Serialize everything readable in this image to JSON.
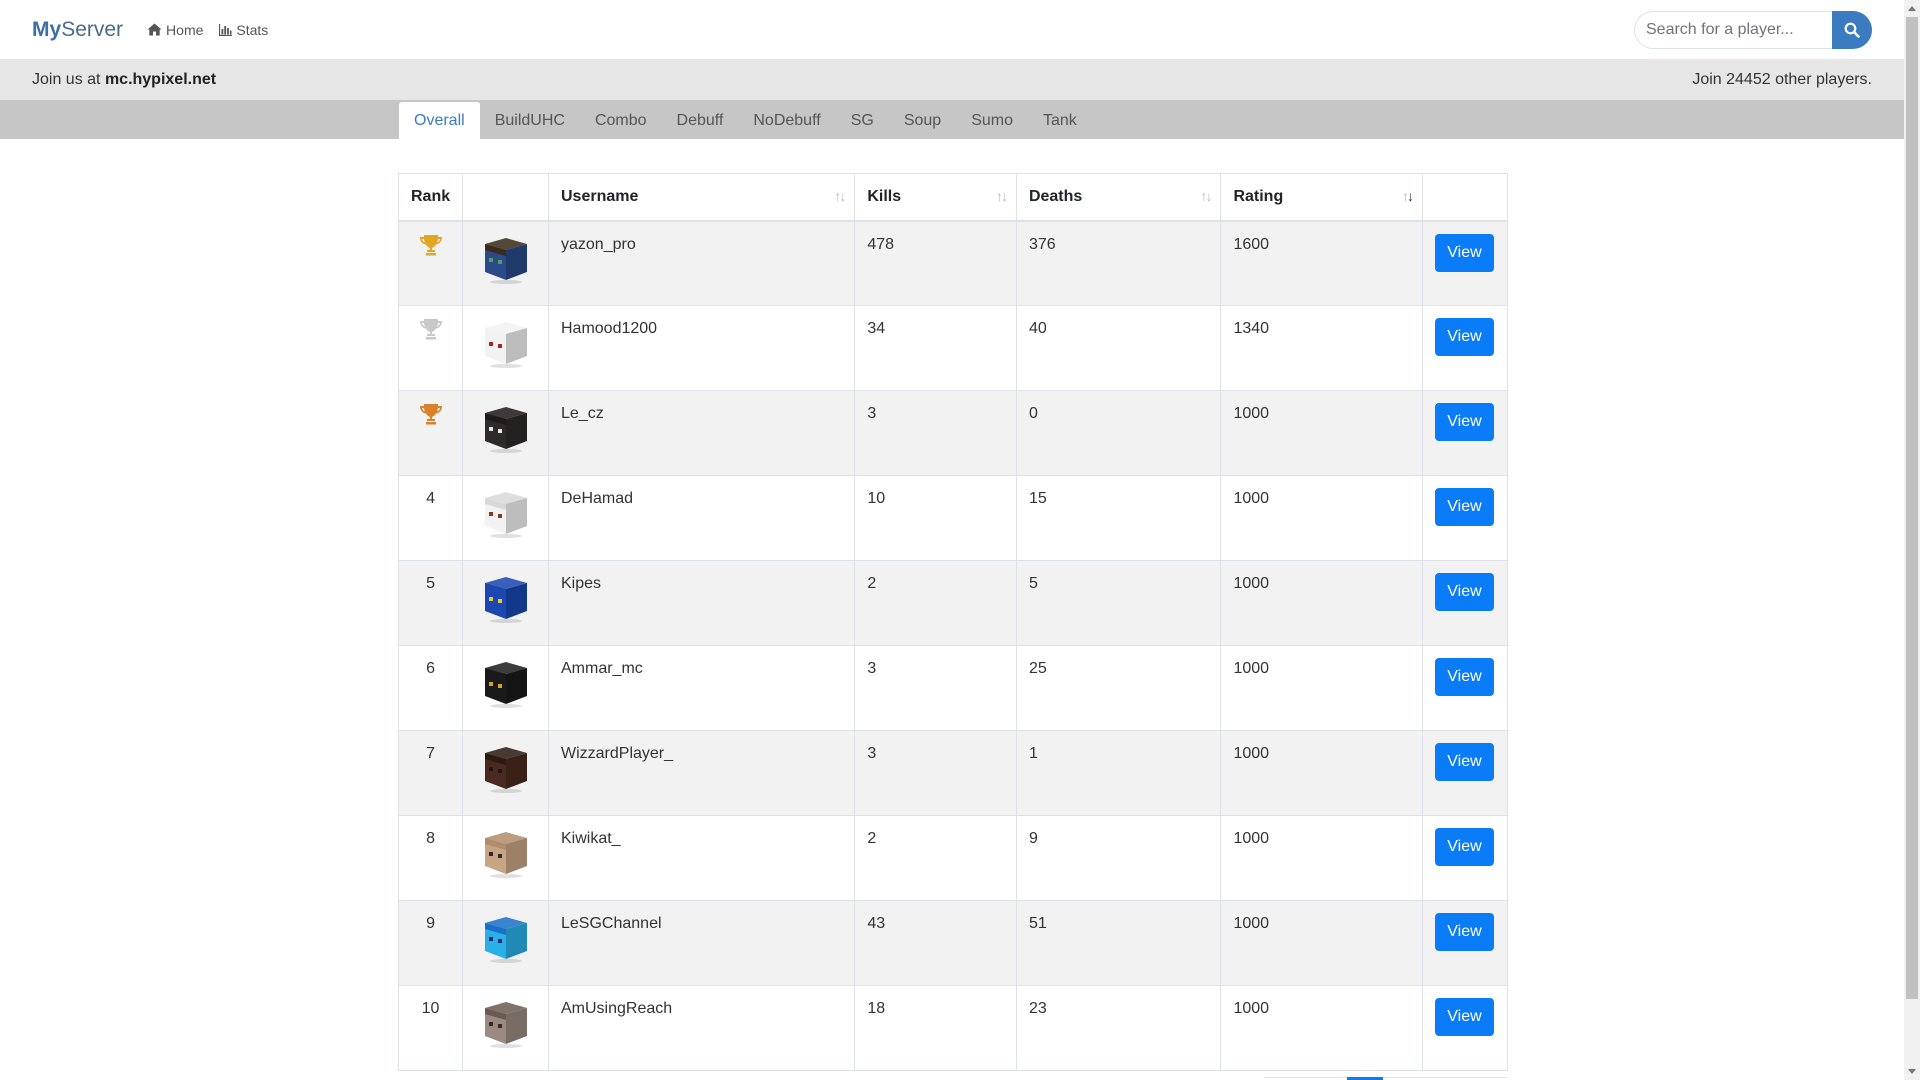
{
  "navbar": {
    "brand_strong": "My",
    "brand_rest": "Server",
    "links": [
      {
        "label": "Home",
        "icon": "home-icon"
      },
      {
        "label": "Stats",
        "icon": "bar-chart-icon"
      }
    ],
    "search_placeholder": "Search for a player...",
    "search_icon": "search-icon"
  },
  "infobar": {
    "join_prefix": "Join us at ",
    "server_address": "mc.hypixel.net",
    "player_count_text": "Join 24452 other players."
  },
  "tabs": [
    {
      "label": "Overall",
      "active": true
    },
    {
      "label": "BuildUHC",
      "active": false
    },
    {
      "label": "Combo",
      "active": false
    },
    {
      "label": "Debuff",
      "active": false
    },
    {
      "label": "NoDebuff",
      "active": false
    },
    {
      "label": "SG",
      "active": false
    },
    {
      "label": "Soup",
      "active": false
    },
    {
      "label": "Sumo",
      "active": false
    },
    {
      "label": "Tank",
      "active": false
    }
  ],
  "table": {
    "headers": {
      "rank": "Rank",
      "skin": "",
      "username": "Username",
      "kills": "Kills",
      "deaths": "Deaths",
      "rating": "Rating",
      "actions": ""
    },
    "sorted_column": "rating",
    "view_label": "View",
    "trophy_colors": {
      "gold": "#e2a622",
      "silver": "#c8c8c8",
      "bronze": "#d9822b"
    },
    "rows": [
      {
        "rank": "",
        "trophy": "gold",
        "username": "yazon_pro",
        "kills": "478",
        "deaths": "376",
        "rating": "1600",
        "skin": {
          "face": "#2a4a8a",
          "hair": "#3a2a1a",
          "accent": "#5a9a5a"
        }
      },
      {
        "rank": "",
        "trophy": "silver",
        "username": "Hamood1200",
        "kills": "34",
        "deaths": "40",
        "rating": "1340",
        "skin": {
          "face": "#f2f2f2",
          "hair": "#f2f2f2",
          "accent": "#b02020"
        }
      },
      {
        "rank": "",
        "trophy": "bronze",
        "username": "Le_cz",
        "kills": "3",
        "deaths": "0",
        "rating": "1000",
        "skin": {
          "face": "#2e2a2a",
          "hair": "#1e1a1a",
          "accent": "#e8e8e8"
        }
      },
      {
        "rank": "4",
        "trophy": "",
        "username": "DeHamad",
        "kills": "10",
        "deaths": "15",
        "rating": "1000",
        "skin": {
          "face": "#f2f2f2",
          "hair": "#d8d8d8",
          "accent": "#8a3a1a"
        }
      },
      {
        "rank": "5",
        "trophy": "",
        "username": "Kipes",
        "kills": "2",
        "deaths": "5",
        "rating": "1000",
        "skin": {
          "face": "#1a48b0",
          "hair": "#1a48b0",
          "accent": "#e8c840"
        }
      },
      {
        "rank": "6",
        "trophy": "",
        "username": "Ammar_mc",
        "kills": "3",
        "deaths": "25",
        "rating": "1000",
        "skin": {
          "face": "#1a1a1a",
          "hair": "#1a1a1a",
          "accent": "#e0a020"
        }
      },
      {
        "rank": "7",
        "trophy": "",
        "username": "WizzardPlayer_",
        "kills": "3",
        "deaths": "1",
        "rating": "1000",
        "skin": {
          "face": "#4a2a1e",
          "hair": "#2a1a12",
          "accent": "#1a1a1a"
        }
      },
      {
        "rank": "8",
        "trophy": "",
        "username": "Kiwikat_",
        "kills": "2",
        "deaths": "9",
        "rating": "1000",
        "skin": {
          "face": "#c8a484",
          "hair": "#b08c6c",
          "accent": "#2a2a2a"
        }
      },
      {
        "rank": "9",
        "trophy": "",
        "username": "LeSGChannel",
        "kills": "43",
        "deaths": "51",
        "rating": "1000",
        "skin": {
          "face": "#2ab0e8",
          "hair": "#1a70c8",
          "accent": "#1a2a6a"
        }
      },
      {
        "rank": "10",
        "trophy": "",
        "username": "AmUsingReach",
        "kills": "18",
        "deaths": "23",
        "rating": "1000",
        "skin": {
          "face": "#9a8a80",
          "hair": "#6a5a52",
          "accent": "#3a2a22"
        }
      }
    ]
  }
}
